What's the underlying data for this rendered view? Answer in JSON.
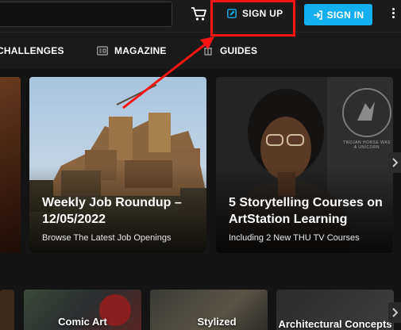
{
  "header": {
    "signup_label": "SIGN UP",
    "signin_label": "SIGN IN",
    "icons": [
      "cart-icon",
      "edit-icon",
      "sign-in-icon",
      "more-vertical-icon"
    ],
    "colors": {
      "signin_bg": "#13aff0",
      "highlight": "#ff1414",
      "background": "#1b1b1b"
    }
  },
  "nav": {
    "items": [
      {
        "label": "CHALLENGES",
        "icon": ""
      },
      {
        "label": "MAGAZINE",
        "icon": "magazine-icon"
      },
      {
        "label": "GUIDES",
        "icon": "guides-icon"
      }
    ]
  },
  "cards": [
    {
      "title": "Weekly Job Roundup – 12/05/2022",
      "subtitle": "Browse The Latest Job Openings"
    },
    {
      "title": "5 Storytelling Courses on ArtStation Learning",
      "subtitle": "Including 2 New THU TV Courses"
    }
  ],
  "logo_text": "TROJAN HORSE WAS A UNICORN",
  "categories": [
    "Comic Art",
    "Stylized",
    "Architectural Concepts"
  ]
}
